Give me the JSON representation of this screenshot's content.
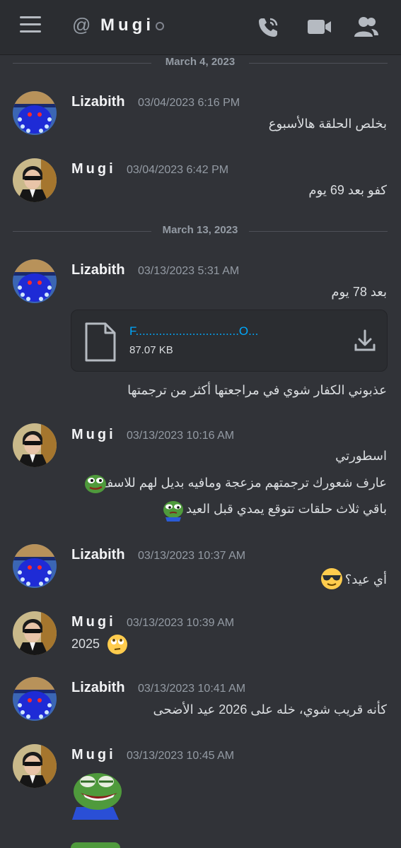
{
  "header": {
    "channel_name": "Mugi",
    "at_symbol": "@"
  },
  "dividers": [
    {
      "date": "March 4, 2023"
    },
    {
      "date": "March 13, 2023"
    }
  ],
  "messages": [
    {
      "author": "Lizabith",
      "timestamp": "03/04/2023 6:16 PM",
      "lines": [
        "بخلص الحلقة هالأسبوع"
      ]
    },
    {
      "author": "Mugi",
      "timestamp": "03/04/2023 6:42 PM",
      "lines": [
        "كفو بعد 69 يوم"
      ]
    },
    {
      "author": "Lizabith",
      "timestamp": "03/13/2023 5:31 AM",
      "lines": [
        "بعد 78 يوم",
        "عذبوني الكفار شوي في مراجعتها أكثر من ترجمتها"
      ]
    },
    {
      "author": "Mugi",
      "timestamp": "03/13/2023 10:16 AM",
      "lines": [
        "اسطورتي",
        "عارف شعورك ترجمتهم مزعجة ومافيه بديل لهم للاسف",
        "باقي ثلاث حلقات تتوقع يمدي قبل العيد"
      ]
    },
    {
      "author": "Lizabith",
      "timestamp": "03/13/2023 10:37 AM",
      "lines": [
        "أي عيد؟"
      ]
    },
    {
      "author": "Mugi",
      "timestamp": "03/13/2023 10:39 AM",
      "lines": [
        "2025"
      ]
    },
    {
      "author": "Lizabith",
      "timestamp": "03/13/2023 10:41 AM",
      "lines": [
        "كأنه قريب شوي، خله على 2026 عيد الأضحى"
      ]
    },
    {
      "author": "Mugi",
      "timestamp": "03/13/2023 10:45 AM",
      "lines": []
    }
  ],
  "attachment": {
    "file_name": "F...............................O...",
    "file_size": "87.07 KB"
  },
  "icons": {
    "menu": "hamburger-icon",
    "call": "phone-call-icon",
    "video": "video-camera-icon",
    "members": "members-icon",
    "file": "file-icon",
    "download": "download-icon"
  },
  "colors": {
    "background": "#313338",
    "header": "#2b2d31",
    "link": "#00a8fc",
    "timestamp": "#949ba4"
  }
}
